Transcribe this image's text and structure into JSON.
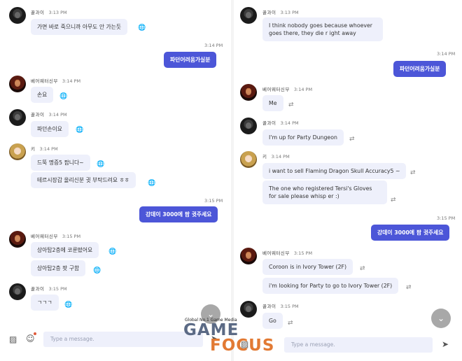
{
  "left": {
    "messages": [
      {
        "name": "꿀과이",
        "time": "3:13 PM",
        "text": "가면 바로 죽으니까 아무도 안 가는듯"
      },
      {
        "mine_time": "3:14 PM",
        "mine_text": "파던어려움가실분"
      },
      {
        "name": "베어웨터신부",
        "time": "3:14 PM",
        "text": "손요"
      },
      {
        "name": "꿀과이",
        "time": "3:14 PM",
        "text": "파던손이요"
      },
      {
        "name": "키",
        "time": "3:14 PM",
        "text": "드뚝 명증5 팝니다~",
        "text2": "테르시장갑 올리신분 귓 부탁드려요 ㅎㅎ"
      },
      {
        "mine_time": "3:15 PM",
        "mine_text": "강데이 3000에 팜 귓주세요"
      },
      {
        "name": "베어웨터신부",
        "time": "3:15 PM",
        "text": "상아탑2층에 코룬떴어요",
        "text2": "상아탑2층 팟 구함"
      },
      {
        "name": "꿀과이",
        "time": "3:15 PM",
        "text": "ㄱㄱㄱ"
      }
    ],
    "input_placeholder": "Type a message."
  },
  "right": {
    "messages": [
      {
        "name": "꿀과이",
        "time": "3:13 PM",
        "text": "I think nobody goes because whoever goes there, they die r ight away"
      },
      {
        "mine_time": "3:14 PM",
        "mine_text": "파던어려움가실분"
      },
      {
        "name": "베어웨터신부",
        "time": "3:14 PM",
        "text": "Me"
      },
      {
        "name": "꿀과이",
        "time": "3:14 PM",
        "text": "I'm up for Party Dungeon"
      },
      {
        "name": "키",
        "time": "3:14 PM",
        "text": "i want to sell Flaming Dragon Skull Accuracy5 ~",
        "text2": "The one who registered Tersi's Gloves for sale please whisp er :)"
      },
      {
        "mine_time": "3:15 PM",
        "mine_text": "강데이 3000에 팜 귓주세요"
      },
      {
        "name": "베어웨터신부",
        "time": "3:15 PM",
        "text": "Coroon is in Ivory Tower (2F)",
        "text2": "i'm looking for Party to go to Ivory Tower (2F)"
      },
      {
        "name": "꿀과이",
        "time": "3:15 PM",
        "text": "Go"
      }
    ],
    "input_placeholder": "Type a message."
  },
  "watermark": {
    "tagline": "Global No.1 Game Media",
    "word1": "GAME",
    "word2": "FOCUS"
  },
  "icons": {
    "translate_left": "globe-icon",
    "translate_right": "swap-icon",
    "scroll": "chevron-down-icon",
    "image": "image-icon",
    "emoji": "emoji-icon",
    "send": "send-icon"
  }
}
